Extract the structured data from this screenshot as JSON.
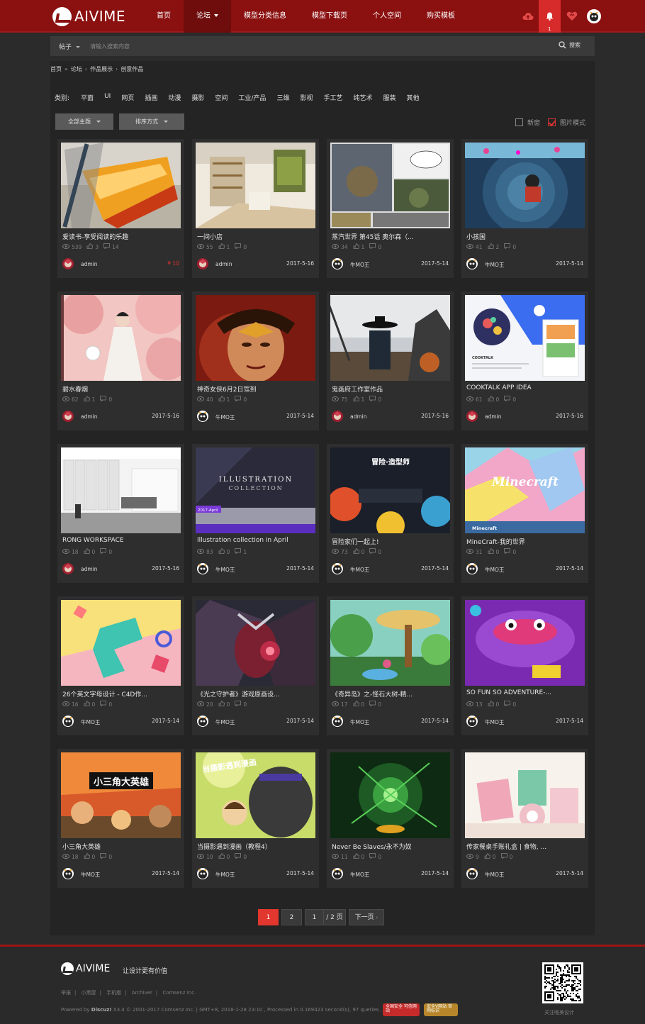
{
  "header": {
    "logo_text": "AIVIME",
    "nav": [
      {
        "label": "首页"
      },
      {
        "label": "论坛",
        "active": true,
        "dropdown": true
      },
      {
        "label": "模型分类信息"
      },
      {
        "label": "模型下载页"
      },
      {
        "label": "个人空间"
      },
      {
        "label": "购买模板"
      }
    ],
    "notification_count": "1"
  },
  "search": {
    "type_label": "帖子",
    "placeholder": "请输入搜索内容",
    "button_label": "搜索"
  },
  "breadcrumb": [
    "首页",
    "论坛",
    "作品展示",
    "创意作品"
  ],
  "categories": {
    "label": "类别:",
    "items": [
      "平面",
      "UI",
      "网页",
      "插画",
      "动漫",
      "摄影",
      "空间",
      "工业/产品",
      "三维",
      "影视",
      "手工艺",
      "纯艺术",
      "服装",
      "其他"
    ]
  },
  "filters": {
    "theme_label": "全部主题",
    "sort_label": "排序方式",
    "new_window_label": "新窗",
    "image_mode_label": "图片模式"
  },
  "cards": [
    {
      "title": "爱读书-享受阅读的乐趣",
      "views": "539",
      "likes": "3",
      "replies": "14",
      "author": "admin",
      "date": "",
      "price": "¥ 10",
      "thumb": "pencil"
    },
    {
      "title": "一间小店",
      "views": "55",
      "likes": "1",
      "replies": "0",
      "author": "admin",
      "date": "2017-5-16",
      "thumb": "shop"
    },
    {
      "title": "蒸汽世界 第45话 奥尔森（...",
      "views": "34",
      "likes": "1",
      "replies": "0",
      "author": "牛MO王",
      "date": "2017-5-14",
      "thumb": "comic"
    },
    {
      "title": "小孩国",
      "views": "41",
      "likes": "2",
      "replies": "0",
      "author": "牛MO王",
      "date": "2017-5-14",
      "thumb": "kid"
    },
    {
      "title": "碧水春烟",
      "views": "62",
      "likes": "1",
      "replies": "0",
      "author": "admin",
      "date": "2017-5-16",
      "thumb": "blossom"
    },
    {
      "title": "神奇女侠6月2日驾到",
      "views": "40",
      "likes": "1",
      "replies": "0",
      "author": "牛MO王",
      "date": "2017-5-14",
      "thumb": "wonder"
    },
    {
      "title": "鬼画府工作室作品",
      "views": "75",
      "likes": "1",
      "replies": "0",
      "author": "admin",
      "date": "2017-5-16",
      "thumb": "warrior"
    },
    {
      "title": "COOKTALK APP IDEA",
      "views": "61",
      "likes": "0",
      "replies": "0",
      "author": "admin",
      "date": "2017-5-16",
      "thumb": "cooktalk"
    },
    {
      "title": "RONG WORKSPACE",
      "views": "18",
      "likes": "0",
      "replies": "0",
      "author": "admin",
      "date": "2017-5-16",
      "thumb": "workspace"
    },
    {
      "title": "Illustration collection in April",
      "views": "83",
      "likes": "0",
      "replies": "1",
      "author": "牛MO王",
      "date": "2017-5-14",
      "thumb": "illustration"
    },
    {
      "title": "冒险家们一起上!",
      "views": "73",
      "likes": "0",
      "replies": "0",
      "author": "牛MO王",
      "date": "2017-5-14",
      "thumb": "adventure"
    },
    {
      "title": "MineCraft-我的世界",
      "views": "31",
      "likes": "0",
      "replies": "0",
      "author": "牛MO王",
      "date": "2017-5-14",
      "thumb": "minecraft"
    },
    {
      "title": "26个英文字母设计 - C4D作...",
      "views": "16",
      "likes": "0",
      "replies": "0",
      "author": "牛MO王",
      "date": "2017-5-14",
      "thumb": "letters"
    },
    {
      "title": "《光之守护者》游戏原画设...",
      "views": "20",
      "likes": "0",
      "replies": "0",
      "author": "牛MO王",
      "date": "2017-5-14",
      "thumb": "guardian"
    },
    {
      "title": "《奇异岛》之-怪石大树-精...",
      "views": "17",
      "likes": "0",
      "replies": "0",
      "author": "牛MO王",
      "date": "2017-5-14",
      "thumb": "island"
    },
    {
      "title": "SO FUN SO ADVENTURE-...",
      "views": "13",
      "likes": "0",
      "replies": "0",
      "author": "牛MO王",
      "date": "2017-5-14",
      "thumb": "sofun"
    },
    {
      "title": "小三角大英雄",
      "views": "18",
      "likes": "0",
      "replies": "0",
      "author": "牛MO王",
      "date": "2017-5-14",
      "thumb": "heroes"
    },
    {
      "title": "当摄影遇到漫画（教程4）",
      "views": "10",
      "likes": "0",
      "replies": "0",
      "author": "牛MO王",
      "date": "2017-5-14",
      "thumb": "photo"
    },
    {
      "title": "Never Be Slaves/永不为奴",
      "views": "11",
      "likes": "0",
      "replies": "0",
      "author": "牛MO王",
      "date": "2017-5-14",
      "thumb": "slaves"
    },
    {
      "title": "传家餐桌手账礼盒 | 食物, ...",
      "views": "9",
      "likes": "0",
      "replies": "0",
      "author": "牛MO王",
      "date": "2017-5-14",
      "thumb": "giftbox"
    }
  ],
  "thumb_texts": {
    "illustration": [
      "ILLUSTRATION",
      "COLLECTION",
      "2017-April"
    ],
    "adventure": "冒险·造型师",
    "minecraft": [
      "Minecraft",
      "Minecraft"
    ],
    "heroes": "小三角大英雄",
    "photo": "当摄影遇到漫画",
    "cooktalk": "COOKTALK"
  },
  "pagination": {
    "current": "1",
    "pages": [
      "2"
    ],
    "jump_value": "1",
    "total_label": "/ 2 页",
    "next_label": "下一页"
  },
  "footer": {
    "logo_text": "AIVIME",
    "slogan": "让设计更有价值",
    "links": [
      "举报",
      "小黑屋",
      "手机版",
      "Archiver",
      "Comsenz Inc."
    ],
    "copyright_prefix": "Powered by ",
    "copyright_brand": "Discuz!",
    "copyright_rest": " X3.4  © 2001-2017 Comsenz Inc.  |  GMT+8, 2018-1-28 23:10 , Processed in 0.169423 second(s), 97 queries .",
    "badge1": "全国安全 可信网站",
    "badge2": "安全V网站 官网标识",
    "qr_label": "关注唯美设计"
  },
  "colors": {
    "brand_red": "#8b1010",
    "accent_red": "#e2372e",
    "panel_bg": "#242424",
    "card_bg": "#2e2e2e"
  }
}
